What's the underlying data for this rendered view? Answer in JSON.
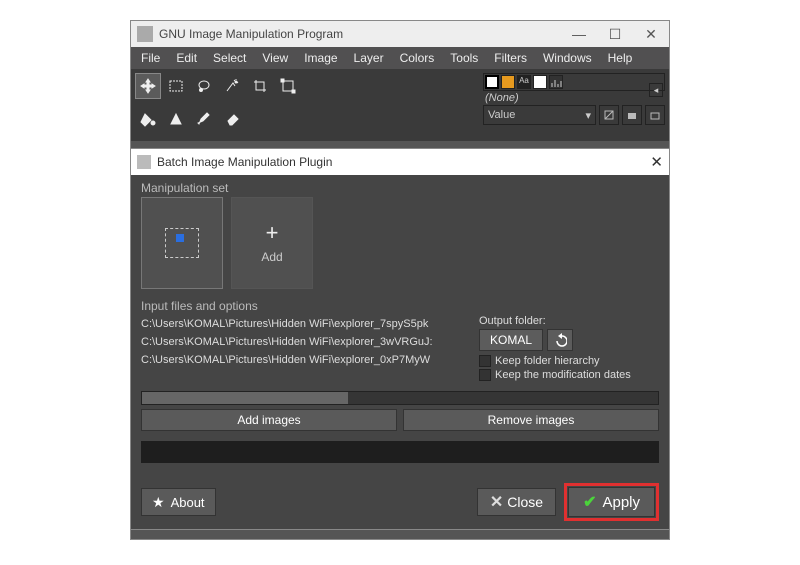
{
  "window": {
    "title": "GNU Image Manipulation Program",
    "controls": {
      "min": "—",
      "max": "☐",
      "close": "✕"
    }
  },
  "menubar": [
    "File",
    "Edit",
    "Select",
    "View",
    "Image",
    "Layer",
    "Colors",
    "Tools",
    "Filters",
    "Windows",
    "Help"
  ],
  "right_panel": {
    "none_label": "(None)",
    "combo": "Value"
  },
  "dialog": {
    "title": "Batch Image Manipulation Plugin",
    "manip_label": "Manipulation set",
    "add_tile_label": "Add",
    "input_files_label": "Input files and options",
    "files": [
      "C:\\Users\\KOMAL\\Pictures\\Hidden WiFi\\explorer_7spyS5pk",
      "C:\\Users\\KOMAL\\Pictures\\Hidden WiFi\\explorer_3wVRGuJ:",
      "C:\\Users\\KOMAL\\Pictures\\Hidden WiFi\\explorer_0xP7MyW"
    ],
    "output_folder_label": "Output folder:",
    "output_folder_value": "KOMAL",
    "keep_hierarchy": "Keep folder hierarchy",
    "keep_dates": "Keep the modification dates",
    "add_images": "Add images",
    "remove_images": "Remove images",
    "about": "About",
    "close": "Close",
    "apply": "Apply"
  }
}
